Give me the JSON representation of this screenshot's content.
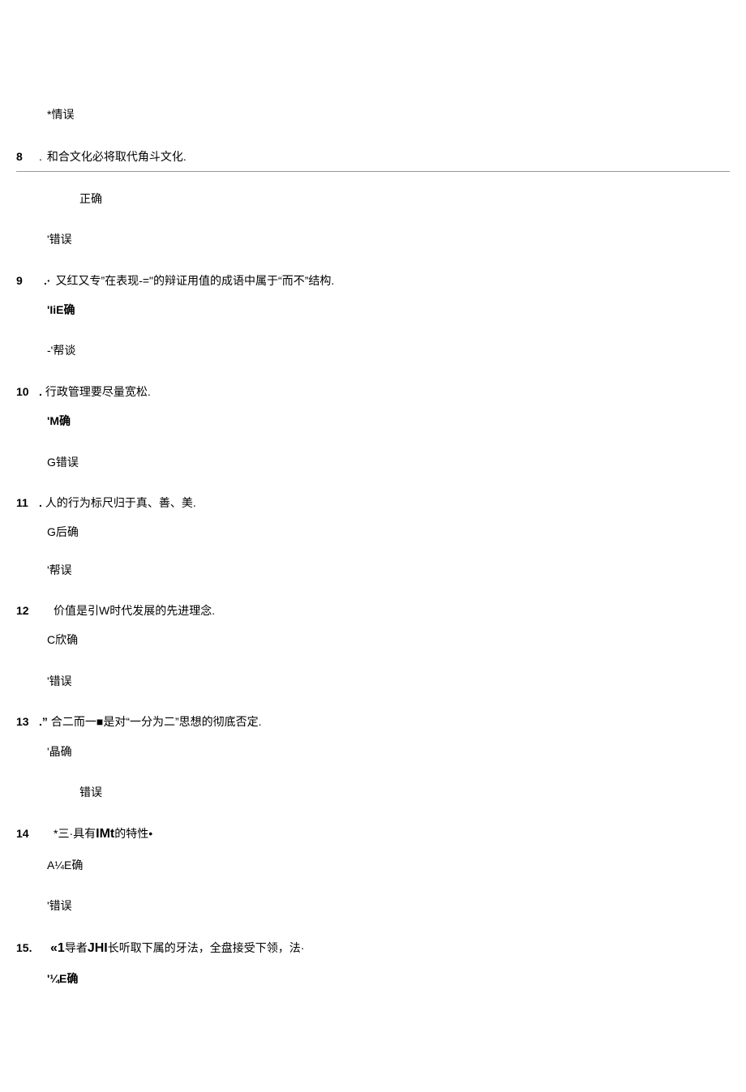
{
  "preAnswer": "*情误",
  "questions": [
    {
      "number": "8",
      "dot": ".",
      "text": "和合文化必将取代角斗文化.",
      "option1": "正确",
      "option2": "'错误",
      "underlined": true,
      "opt1Indent": true
    },
    {
      "number": "9",
      "dot": ".·",
      "text": "又红又专”在表现-=\"的辩证用值的成语中属于“而不”结构.",
      "option1": "'IiE确",
      "option2": "-'帮谈",
      "opt1Bold": true
    },
    {
      "number": "10",
      "dot": ".",
      "text": "行政管理要尽量宽松.",
      "option1": "'M确",
      "option2": "G错误",
      "opt1Bold": true,
      "opt2Bold": false
    },
    {
      "number": "11",
      "dot": ".",
      "text": "人的行为标尺归于真、善、美.",
      "option1": "G后确",
      "option2": "'帮误",
      "opt1Bold": false
    },
    {
      "number": "12",
      "dot": "",
      "text": "价值是引W时代发展的先进理念.",
      "option1": "C欣确",
      "option2": "'错误",
      "textIndent": true
    },
    {
      "number": "13",
      "dot": ".”",
      "text": "合二而一■是对“一分为二”思想的彻底否定.",
      "option1": "'晶确",
      "option2": "错误",
      "opt2Indent": true
    },
    {
      "number": "14",
      "dot": "",
      "textPre": "*三·具有",
      "textBold": "IMt",
      "textPost": "的特性•",
      "option1": "A¼E确",
      "option2": "'错误",
      "textIndent": true,
      "complex": true
    },
    {
      "number": "15.",
      "dot": "",
      "textPre": "«",
      "textBold1": "1",
      "textMid": "导者",
      "textBold2": "JHI",
      "textPost": "长听取下属的牙法，全盘接受下领，法·",
      "option1": "'¼E确",
      "complex15": true,
      "opt1Bold": true
    }
  ]
}
